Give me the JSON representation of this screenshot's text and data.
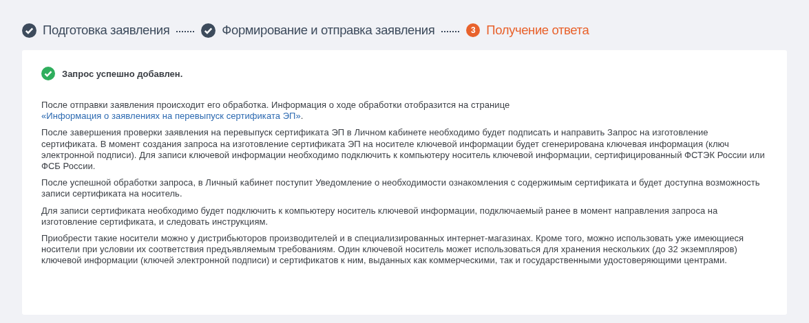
{
  "steps": [
    {
      "label": "Подготовка заявления",
      "kind": "done"
    },
    {
      "label": "Формирование и отправка заявления",
      "kind": "done"
    },
    {
      "label": "Получение ответа",
      "kind": "current",
      "number": "3"
    }
  ],
  "message": {
    "text": "Запрос успешно добавлен.",
    "kind": "success"
  },
  "paragraphs": [
    {
      "text": "После отправки заявления происходит его обработка. Информация о ходе обработки отобразится на странице ",
      "link": "«Информация о заявлениях на перевыпуск сертификата ЭП»",
      "tail": "."
    },
    {
      "text": "После завершения проверки заявления на перевыпуск сертификата ЭП в Личном кабинете необходимо будет подписать и направить Запрос на изготовление сертификата. В момент создания запроса на изготовление сертификата ЭП на носителе ключевой информации будет сгенерирована ключевая информация (ключ электронной подписи). Для записи ключевой информации необходимо подключить к компьютеру носитель ключевой информации, сертифицированный ФСТЭК России или ФСБ России."
    },
    {
      "text": "После успешной обработки запроса, в Личный кабинет поступит Уведомление о необходимости ознакомления с содержимым сертификата и будет доступна возможность записи сертификата на носитель."
    },
    {
      "text": "Для записи сертификата необходимо будет подключить к компьютеру носитель ключевой информации, подключаемый ранее в момент направления запроса на изготовление сертификата, и следовать инструкциям."
    },
    {
      "text": "Приобрести такие носители можно у дистрибьюторов производителей и в специализированных интернет-магазинах. Кроме того, можно использовать уже имеющиеся носители при условии их соответствия предъявляемым требованиям. Один ключевой носитель может использоваться для хранения нескольких (до 32 экземпляров) ключевой информации (ключей электронной подписи) и сертификатов к ним, выданных как коммерческими, так и государственными удостоверяющими центрами."
    }
  ]
}
